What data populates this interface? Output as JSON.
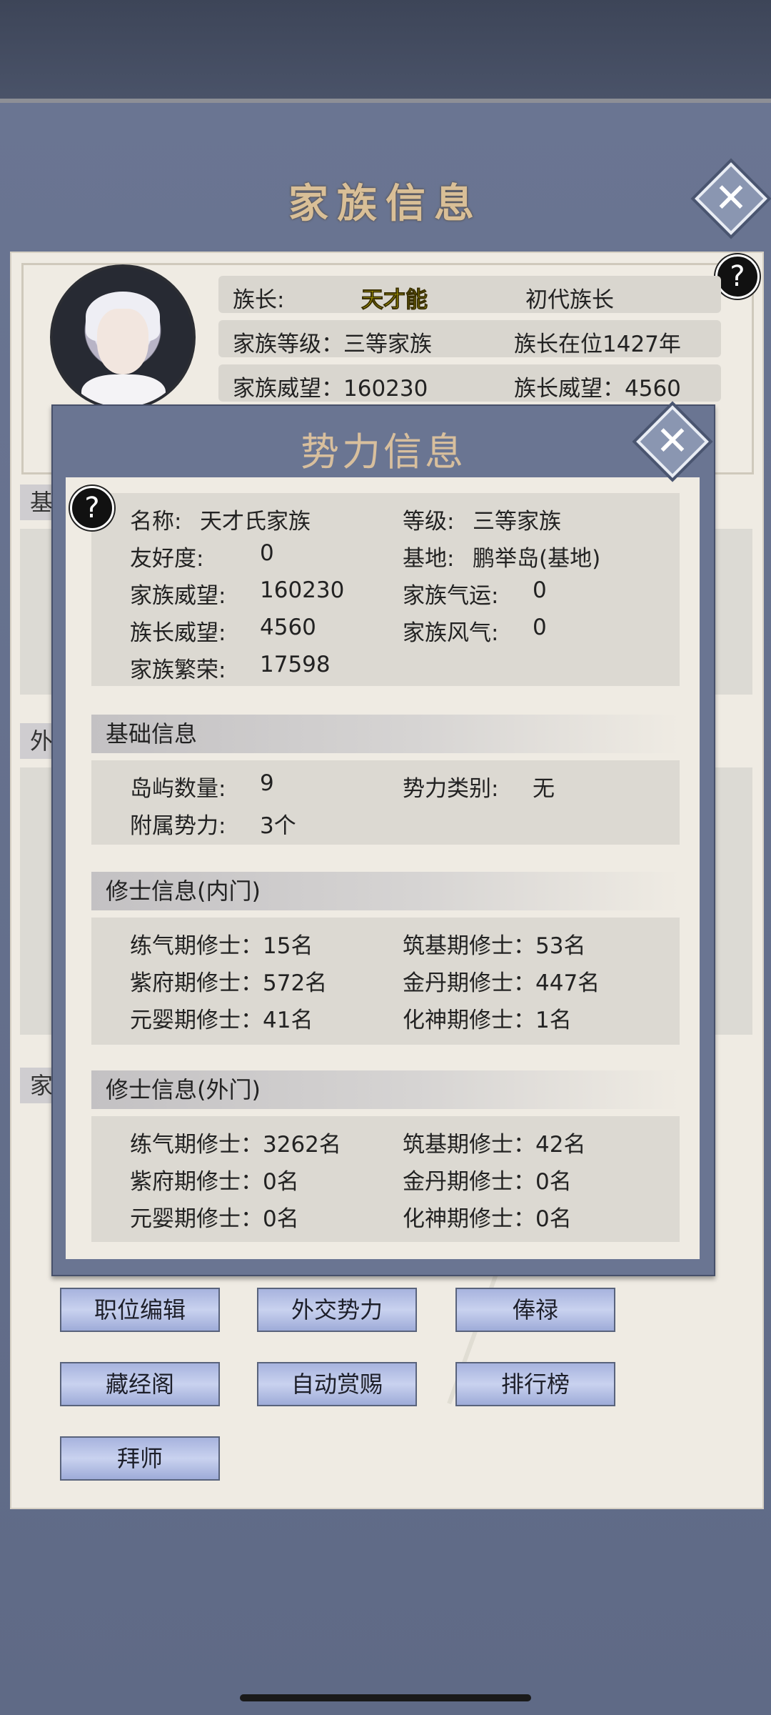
{
  "page": {
    "title": "家族信息"
  },
  "family_header": {
    "leader_label": "族长:",
    "leader_name": "天才能",
    "leader_title": "初代族长",
    "level_text": "家族等级：三等家族",
    "tenure_text": "族长在位1427年",
    "prestige_text": "家族威望：160230",
    "leader_prestige_text": "族长威望：4560"
  },
  "background_sections": {
    "s1": "基",
    "s2": "外",
    "s3": "家"
  },
  "buttons": {
    "position_edit": "职位编辑",
    "diplomacy": "外交势力",
    "salary": "俸禄",
    "library": "藏经阁",
    "auto_reward": "自动赏赐",
    "ranking": "排行榜",
    "apprentice": "拜师"
  },
  "modal": {
    "title": "势力信息",
    "overview": {
      "name_label": "名称:",
      "name_value": "天才氏家族",
      "level_label": "等级:",
      "level_value": "三等家族",
      "friendship_label": "友好度:",
      "friendship_value": "0",
      "base_label": "基地:",
      "base_value": "鹏举岛(基地)",
      "prestige_label": "家族威望:",
      "prestige_value": "160230",
      "fortune_label": "家族气运:",
      "fortune_value": "0",
      "leader_prestige_label": "族长威望:",
      "leader_prestige_value": "4560",
      "ethos_label": "家族风气:",
      "ethos_value": "0",
      "prosperity_label": "家族繁荣:",
      "prosperity_value": "17598"
    },
    "basic": {
      "header": "基础信息",
      "islands_label": "岛屿数量:",
      "islands_value": "9",
      "type_label": "势力类别:",
      "type_value": "无",
      "affiliates_label": "附属势力:",
      "affiliates_value": "3个"
    },
    "inner": {
      "header": "修士信息(内门)",
      "qi": "练气期修士：15名",
      "foundation": "筑基期修士：53名",
      "zifu": "紫府期修士：572名",
      "jindan": "金丹期修士：447名",
      "yuanying": "元婴期修士：41名",
      "huashen": "化神期修士：1名"
    },
    "outer": {
      "header": "修士信息(外门)",
      "qi": "练气期修士：3262名",
      "foundation": "筑基期修士：42名",
      "zifu": "紫府期修士：0名",
      "jindan": "金丹期修士：0名",
      "yuanying": "元婴期修士：0名",
      "huashen": "化神期修士：0名"
    }
  },
  "icons": {
    "close": "close-icon",
    "help": "help-icon"
  }
}
